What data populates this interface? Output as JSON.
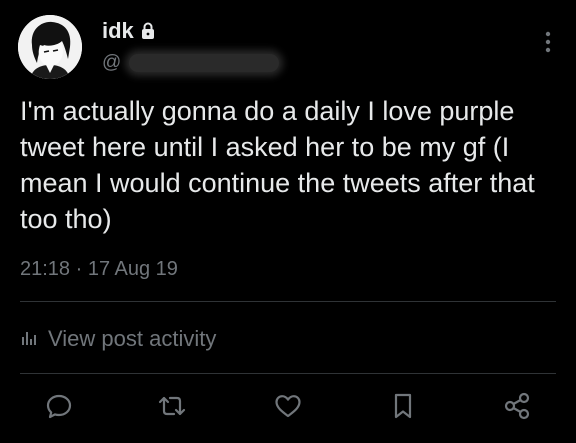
{
  "tweet": {
    "display_name": "idk",
    "handle_prefix": "@",
    "text": "I'm actually gonna do a daily I love purple tweet here until I asked her to be my gf (I mean I would continue the tweets after that too tho)",
    "timestamp": "21:18 · 17 Aug 19"
  },
  "activity": {
    "label": "View post activity"
  },
  "icons": {
    "lock": "lock-icon",
    "more": "more-vertical-icon",
    "activity": "bar-chart-icon",
    "reply": "reply-icon",
    "retweet": "retweet-icon",
    "like": "heart-icon",
    "bookmark": "bookmark-icon",
    "share": "share-icon"
  },
  "colors": {
    "background": "#000000",
    "primary_text": "#e7e9ea",
    "secondary_text": "#71767b",
    "divider": "#2f3336"
  }
}
